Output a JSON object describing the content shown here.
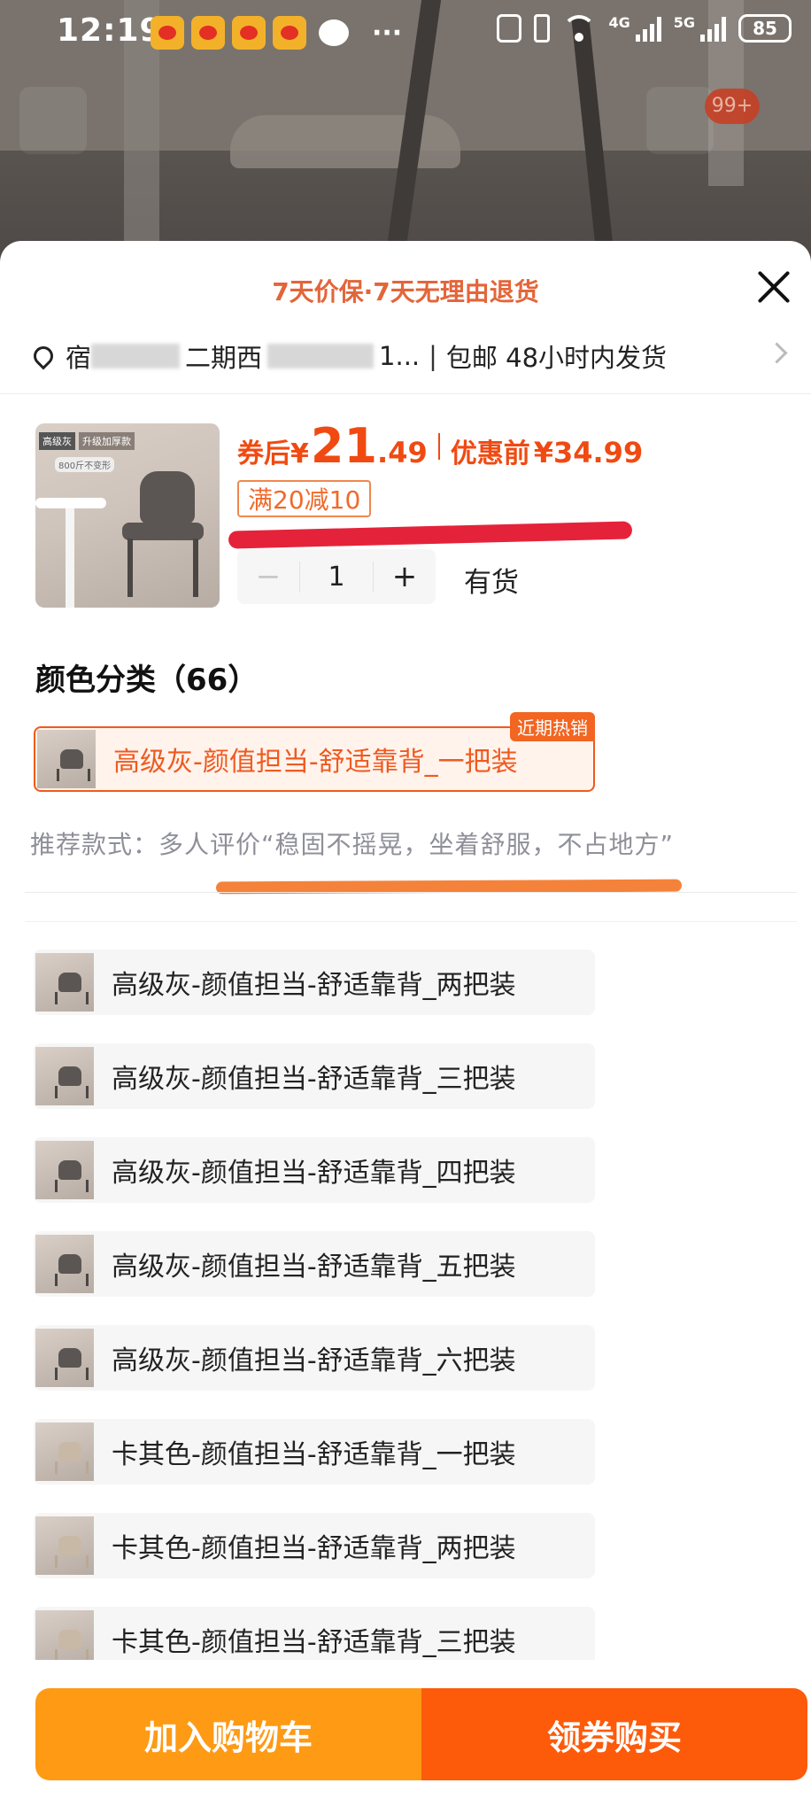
{
  "status_bar": {
    "time": "12:19",
    "more": "···",
    "net_4g": "4G",
    "net_5g": "5G",
    "battery": "85"
  },
  "background": {
    "badge": "99+"
  },
  "sheet": {
    "guarantee": "7天价保·7天无理由退货",
    "address": {
      "part1": "宿",
      "part2": "二期西",
      "part3": "1...",
      "separator": "|",
      "shipping": "包邮 48小时内发货"
    },
    "thumb_tag_1": "高级灰",
    "thumb_tag_2": "升级加厚款",
    "thumb_note": "800斤不变形",
    "price": {
      "prefix": "券后",
      "currency": "¥",
      "int": "21",
      "dec": ".49",
      "orig_label": "优惠前",
      "orig_price": "¥34.99"
    },
    "promo": "满20减10",
    "quantity": {
      "minus": "−",
      "value": "1",
      "plus": "+"
    },
    "stock": "有货",
    "section_title": "颜色分类（66）",
    "selected_option": {
      "label": "高级灰-颜值担当-舒适靠背_一把装",
      "badge": "近期热销"
    },
    "recommend": "推荐款式：多人评价“稳固不摇晃，坐着舒服，不占地方”",
    "options": [
      {
        "label": "高级灰-颜值担当-舒适靠背_两把装",
        "color": "grey"
      },
      {
        "label": "高级灰-颜值担当-舒适靠背_三把装",
        "color": "grey"
      },
      {
        "label": "高级灰-颜值担当-舒适靠背_四把装",
        "color": "grey"
      },
      {
        "label": "高级灰-颜值担当-舒适靠背_五把装",
        "color": "grey"
      },
      {
        "label": "高级灰-颜值担当-舒适靠背_六把装",
        "color": "grey"
      },
      {
        "label": "卡其色-颜值担当-舒适靠背_一把装",
        "color": "khaki"
      },
      {
        "label": "卡其色-颜值担当-舒适靠背_两把装",
        "color": "khaki"
      },
      {
        "label": "卡其色-颜值担当-舒适靠背_三把装",
        "color": "khaki"
      }
    ]
  },
  "actions": {
    "add_to_cart": "加入购物车",
    "buy": "领券购买"
  },
  "colors": {
    "accent_orange": "#fe9a14",
    "accent_red_orange": "#fd5a0a",
    "price_red": "#f04a12"
  }
}
